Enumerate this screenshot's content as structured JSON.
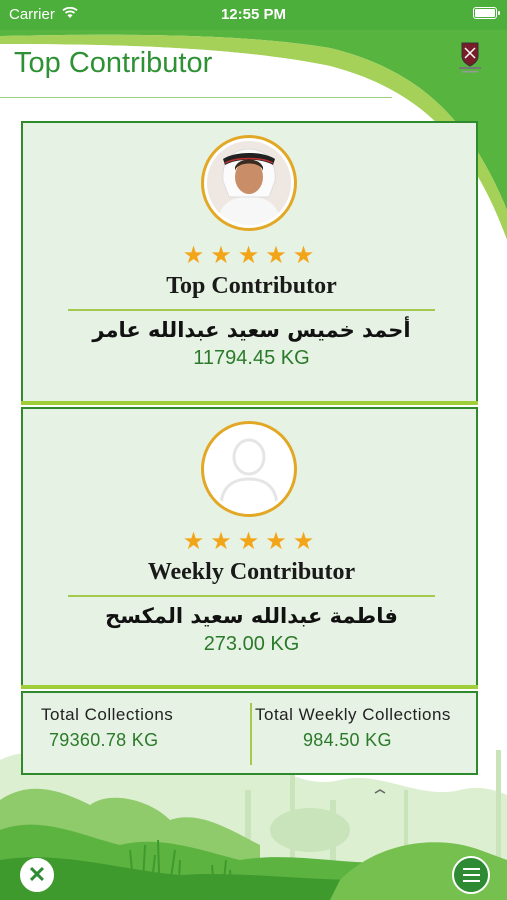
{
  "status_bar": {
    "carrier": "Carrier",
    "time": "12:55 PM"
  },
  "header": {
    "title": "Top Contributor"
  },
  "top_card": {
    "stars": "★★★★★",
    "title": "Top Contributor",
    "name": "أحمد خميس سعيد عبدالله عامر",
    "value": "11794.45 KG"
  },
  "weekly_card": {
    "stars": "★★★★★",
    "title": "Weekly Contributor",
    "name": "فاطمة عبدالله سعيد المكسح",
    "value": "273.00 KG"
  },
  "totals": {
    "total_label": "Total Collections",
    "total_value": "79360.78 KG",
    "weekly_label": "Total Weekly Collections",
    "weekly_value": "984.50 KG"
  },
  "buttons": {
    "close": "✕"
  },
  "colors": {
    "brand_green": "#2e9234",
    "accent_lime": "#9fce39",
    "star": "#f3a51a"
  }
}
